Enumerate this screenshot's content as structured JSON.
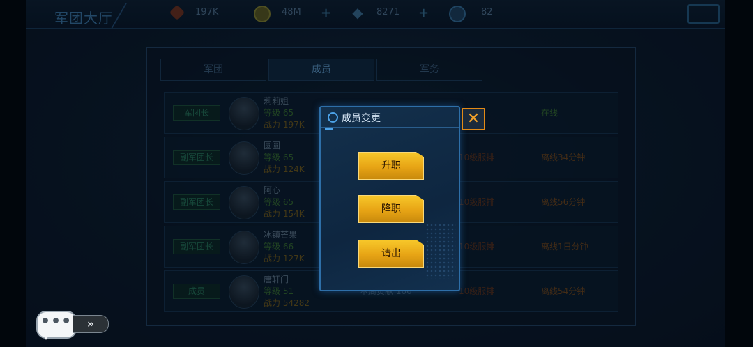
{
  "header": {
    "title": "军团大厅",
    "resources": [
      {
        "icon": "medal-icon",
        "value": "197K"
      },
      {
        "icon": "coin-icon",
        "value": "48M"
      },
      {
        "icon": "diamond-icon",
        "value": "8271"
      },
      {
        "icon": "chat-count-icon",
        "value": "82"
      }
    ]
  },
  "tabs": [
    {
      "label": "军团"
    },
    {
      "label": "成员"
    },
    {
      "label": "军务"
    }
  ],
  "members": [
    {
      "rank": "军团长",
      "name": "莉莉姐",
      "level": "等级 65",
      "power": "战力 197K",
      "week": "",
      "status": "在线",
      "online": true
    },
    {
      "rank": "副军团长",
      "name": "圆圆",
      "level": "等级 65",
      "power": "战力 124K",
      "week": "10级服排",
      "status": "离线34分钟",
      "online": false
    },
    {
      "rank": "副军团长",
      "name": "阿心",
      "level": "等级 65",
      "power": "战力 154K",
      "week": "10级服排",
      "status": "离线56分钟",
      "online": false
    },
    {
      "rank": "副军团长",
      "name": "冰镇芒果",
      "level": "等级 66",
      "power": "战力 127K",
      "week": "10级服排",
      "status": "离线1日分钟",
      "online": false
    },
    {
      "rank": "成员",
      "name": "唐轩门",
      "level": "等级 51",
      "power": "战力 54282",
      "extra": "本周贡献 100",
      "week": "10级服排",
      "status": "离线54分钟",
      "online": false
    }
  ],
  "dialog": {
    "title": "成员变更",
    "actions": [
      "升职",
      "降职",
      "请出"
    ],
    "close_symbol": "✕"
  },
  "chat": {
    "dots": "•••",
    "expand": "»"
  },
  "colors": {
    "accent_gold": "#e7a415",
    "dialog_border": "#2e6fa8",
    "close_orange": "#e38a16"
  }
}
